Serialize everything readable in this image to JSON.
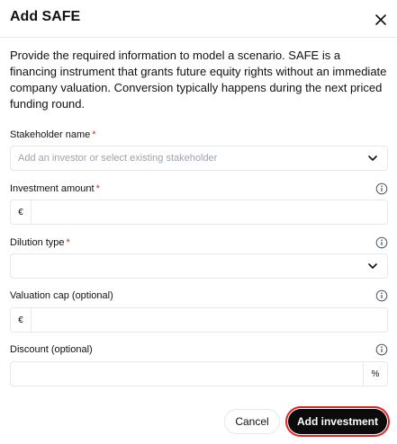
{
  "dialog": {
    "title": "Add SAFE",
    "description": "Provide the required information to model a scenario. SAFE is a financing instrument that grants future equity rights without an immediate company valuation. Conversion typically happens during the next priced funding round."
  },
  "fields": {
    "stakeholder": {
      "label": "Stakeholder name",
      "required_mark": "*",
      "placeholder": "Add an investor or select existing stakeholder",
      "value": ""
    },
    "investment": {
      "label": "Investment amount",
      "required_mark": "*",
      "prefix": "€",
      "value": ""
    },
    "dilution": {
      "label": "Dilution type",
      "required_mark": "*",
      "value": ""
    },
    "valuation_cap": {
      "label": "Valuation cap (optional)",
      "prefix": "€",
      "value": ""
    },
    "discount": {
      "label": "Discount (optional)",
      "suffix": "%",
      "value": ""
    }
  },
  "actions": {
    "cancel": "Cancel",
    "add": "Add investment"
  },
  "icons": {
    "close": "close-icon",
    "info": "info-icon",
    "chevron": "chevron-down-icon"
  },
  "colors": {
    "required": "#dc2626",
    "primary": "#0b0b0b",
    "focus_ring": "#e02424"
  }
}
